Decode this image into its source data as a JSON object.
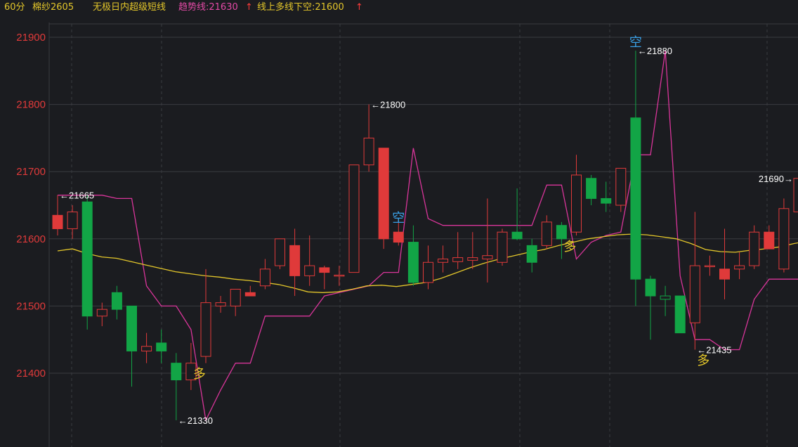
{
  "header": {
    "period": "60分",
    "symbol": "棉纱2605",
    "indicator_name": "无极日内超级短线",
    "trend_label": "趋势线:21630",
    "trend_arrow": "↑",
    "signal_label": "线上多线下空:21600",
    "signal_arrow": "↑"
  },
  "colors": {
    "background": "#1b1c20",
    "grid": "#3a3b40",
    "up": "#e03a3a",
    "down": "#12a546",
    "axis_text": "#e03a3a",
    "trend_line": "#d9359a",
    "ma_line": "#e3c62a",
    "long_signal": "#e3c62a",
    "short_signal": "#3aa0e6",
    "annotation": "#ffffff",
    "header_trend": "#e44aa6",
    "header_signal": "#e3c62a"
  },
  "chart_data": {
    "type": "candlestick",
    "y_ticks": [
      21400,
      21500,
      21600,
      21700,
      21800,
      21900
    ],
    "ylim": [
      21285,
      21935
    ],
    "grid": true,
    "candles": [
      {
        "o": 21615,
        "c": 21635,
        "h": 21665,
        "l": 21605,
        "hollow": false
      },
      {
        "o": 21615,
        "c": 21640,
        "h": 21650,
        "l": 21600,
        "hollow": true
      },
      {
        "o": 21655,
        "c": 21485,
        "h": 21665,
        "l": 21465,
        "hollow": false
      },
      {
        "o": 21485,
        "c": 21495,
        "h": 21505,
        "l": 21470,
        "hollow": true
      },
      {
        "o": 21520,
        "c": 21495,
        "h": 21530,
        "l": 21480,
        "hollow": false
      },
      {
        "o": 21500,
        "c": 21433,
        "h": 21500,
        "l": 21380,
        "hollow": false
      },
      {
        "o": 21433,
        "c": 21440,
        "h": 21460,
        "l": 21415,
        "hollow": true
      },
      {
        "o": 21445,
        "c": 21433,
        "h": 21465,
        "l": 21415,
        "hollow": false
      },
      {
        "o": 21415,
        "c": 21390,
        "h": 21430,
        "l": 21330,
        "hollow": false
      },
      {
        "o": 21390,
        "c": 21415,
        "h": 21445,
        "l": 21375,
        "hollow": true
      },
      {
        "o": 21425,
        "c": 21505,
        "h": 21555,
        "l": 21415,
        "hollow": true
      },
      {
        "o": 21500,
        "c": 21505,
        "h": 21515,
        "l": 21490,
        "hollow": true
      },
      {
        "o": 21500,
        "c": 21525,
        "h": 21525,
        "l": 21485,
        "hollow": true
      },
      {
        "o": 21515,
        "c": 21520,
        "h": 21530,
        "l": 21515,
        "hollow": false
      },
      {
        "o": 21530,
        "c": 21555,
        "h": 21570,
        "l": 21525,
        "hollow": true
      },
      {
        "o": 21560,
        "c": 21600,
        "h": 21600,
        "l": 21555,
        "hollow": true
      },
      {
        "o": 21545,
        "c": 21590,
        "h": 21615,
        "l": 21515,
        "hollow": false
      },
      {
        "o": 21545,
        "c": 21560,
        "h": 21605,
        "l": 21530,
        "hollow": true
      },
      {
        "o": 21550,
        "c": 21557,
        "h": 21560,
        "l": 21525,
        "hollow": false
      },
      {
        "o": 21545,
        "c": 21546,
        "h": 21560,
        "l": 21530,
        "hollow": true
      },
      {
        "o": 21550,
        "c": 21710,
        "h": 21710,
        "l": 21550,
        "hollow": true
      },
      {
        "o": 21710,
        "c": 21750,
        "h": 21800,
        "l": 21700,
        "hollow": true
      },
      {
        "o": 21600,
        "c": 21735,
        "h": 21735,
        "l": 21585,
        "hollow": false
      },
      {
        "o": 21595,
        "c": 21610,
        "h": 21630,
        "l": 21590,
        "hollow": false
      },
      {
        "o": 21595,
        "c": 21535,
        "h": 21620,
        "l": 21530,
        "hollow": false
      },
      {
        "o": 21535,
        "c": 21565,
        "h": 21590,
        "l": 21525,
        "hollow": true
      },
      {
        "o": 21565,
        "c": 21570,
        "h": 21590,
        "l": 21550,
        "hollow": true
      },
      {
        "o": 21566,
        "c": 21572,
        "h": 21610,
        "l": 21555,
        "hollow": true
      },
      {
        "o": 21568,
        "c": 21572,
        "h": 21610,
        "l": 21555,
        "hollow": true
      },
      {
        "o": 21570,
        "c": 21575,
        "h": 21660,
        "l": 21535,
        "hollow": true
      },
      {
        "o": 21565,
        "c": 21610,
        "h": 21615,
        "l": 21560,
        "hollow": true
      },
      {
        "o": 21610,
        "c": 21600,
        "h": 21675,
        "l": 21598,
        "hollow": false
      },
      {
        "o": 21590,
        "c": 21565,
        "h": 21600,
        "l": 21550,
        "hollow": false
      },
      {
        "o": 21590,
        "c": 21625,
        "h": 21635,
        "l": 21585,
        "hollow": true
      },
      {
        "o": 21620,
        "c": 21600,
        "h": 21625,
        "l": 21570,
        "hollow": false
      },
      {
        "o": 21610,
        "c": 21695,
        "h": 21725,
        "l": 21605,
        "hollow": true
      },
      {
        "o": 21690,
        "c": 21660,
        "h": 21695,
        "l": 21650,
        "hollow": false
      },
      {
        "o": 21660,
        "c": 21653,
        "h": 21685,
        "l": 21640,
        "hollow": false
      },
      {
        "o": 21650,
        "c": 21705,
        "h": 21705,
        "l": 21640,
        "hollow": true
      },
      {
        "o": 21780,
        "c": 21540,
        "h": 21880,
        "l": 21500,
        "hollow": false
      },
      {
        "o": 21540,
        "c": 21515,
        "h": 21545,
        "l": 21450,
        "hollow": false
      },
      {
        "o": 21515,
        "c": 21510,
        "h": 21530,
        "l": 21485,
        "hollow": true
      },
      {
        "o": 21515,
        "c": 21460,
        "h": 21515,
        "l": 21460,
        "hollow": false
      },
      {
        "o": 21475,
        "c": 21560,
        "h": 21640,
        "l": 21435,
        "hollow": true
      },
      {
        "o": 21560,
        "c": 21560,
        "h": 21575,
        "l": 21545,
        "hollow": true
      },
      {
        "o": 21540,
        "c": 21555,
        "h": 21615,
        "l": 21510,
        "hollow": false
      },
      {
        "o": 21555,
        "c": 21560,
        "h": 21580,
        "l": 21540,
        "hollow": true
      },
      {
        "o": 21560,
        "c": 21610,
        "h": 21620,
        "l": 21555,
        "hollow": true
      },
      {
        "o": 21585,
        "c": 21610,
        "h": 21620,
        "l": 21585,
        "hollow": false
      },
      {
        "o": 21555,
        "c": 21645,
        "h": 21660,
        "l": 21550,
        "hollow": true
      },
      {
        "o": 21640,
        "c": 21690,
        "h": 21690,
        "l": 21630,
        "hollow": true
      }
    ],
    "trend_line": [
      21665,
      21665,
      21665,
      21665,
      21660,
      21660,
      21530,
      21500,
      21500,
      21465,
      21330,
      21375,
      21415,
      21415,
      21485,
      21485,
      21485,
      21485,
      21515,
      21520,
      21525,
      21530,
      21550,
      21550,
      21735,
      21630,
      21620,
      21620,
      21620,
      21620,
      21620,
      21620,
      21620,
      21680,
      21680,
      21570,
      21595,
      21605,
      21610,
      21725,
      21725,
      21880,
      21545,
      21450,
      21450,
      21435,
      21435,
      21510,
      21540,
      21540,
      21540,
      21550
    ],
    "ma_line": [
      21582,
      21585,
      21578,
      21573,
      21571,
      21566,
      21561,
      21556,
      21551,
      21548,
      21545,
      21543,
      21540,
      21538,
      21535,
      21532,
      21527,
      21521,
      21520,
      21521,
      21525,
      21530,
      21531,
      21529,
      21532,
      21535,
      21541,
      21549,
      21557,
      21564,
      21570,
      21575,
      21580,
      21584,
      21590,
      21595,
      21600,
      21603,
      21606,
      21607,
      21606,
      21603,
      21600,
      21593,
      21584,
      21581,
      21580,
      21583,
      21585,
      21588,
      21593,
      21597
    ],
    "signals": [
      {
        "index": 9,
        "text": "多",
        "type": "long"
      },
      {
        "index": 23,
        "text": "空",
        "type": "short"
      },
      {
        "index": 34,
        "text": "多",
        "type": "long"
      },
      {
        "index": 39,
        "text": "空",
        "type": "short"
      },
      {
        "index": 43,
        "text": "多",
        "type": "long"
      }
    ],
    "annotations": [
      {
        "index": 0,
        "value": 21665,
        "text": "←21665",
        "side": "right"
      },
      {
        "index": 8,
        "value": 21330,
        "text": "←21330",
        "side": "right"
      },
      {
        "index": 21,
        "value": 21800,
        "text": "←21800",
        "side": "right"
      },
      {
        "index": 39,
        "value": 21880,
        "text": "←21880",
        "side": "right"
      },
      {
        "index": 43,
        "value": 21435,
        "text": "←21435",
        "side": "right"
      },
      {
        "index": 50,
        "value": 21690,
        "text": "21690→",
        "side": "left"
      }
    ]
  }
}
